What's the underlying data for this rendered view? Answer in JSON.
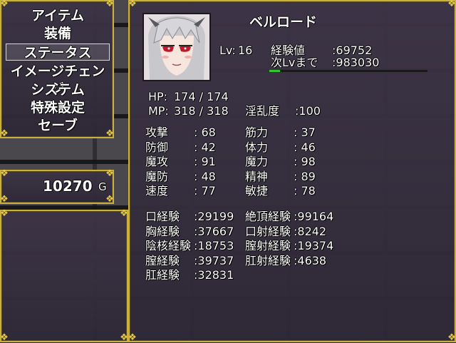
{
  "menu": {
    "items": [
      "アイテム",
      "装備",
      "ステータス",
      "イメージチェンジ",
      "システム",
      "特殊設定",
      "セーブ"
    ],
    "selected_index": 2
  },
  "gold": {
    "amount": "10270",
    "unit": "G"
  },
  "character": {
    "name": "ベルロード",
    "level_label": "Lv:",
    "level": "16",
    "exp_label": "経験値",
    "exp_value": ":69752",
    "next_label": "次Lvまで",
    "next_value": ":983030",
    "next_progress": 0.066,
    "hp_label": "HP:",
    "hp_value": "174 / 174",
    "mp_label": "MP:",
    "mp_value": "318 / 318",
    "lewd_label": "淫乱度",
    "lewd_value": ":100"
  },
  "stats": [
    {
      "label": "攻撃",
      "value": ": 68",
      "label2": "筋力",
      "value2": ": 37"
    },
    {
      "label": "防御",
      "value": ": 42",
      "label2": "体力",
      "value2": ": 46"
    },
    {
      "label": "魔攻",
      "value": ": 91",
      "label2": "魔力",
      "value2": ": 98"
    },
    {
      "label": "魔防",
      "value": ": 48",
      "label2": "精神",
      "value2": ": 89"
    },
    {
      "label": "速度",
      "value": ": 77",
      "label2": "敏捷",
      "value2": ": 78"
    }
  ],
  "experience": [
    {
      "label": "口経験",
      "value": ":29199",
      "label2": "絶頂経験",
      "value2": ":99164"
    },
    {
      "label": "胸経験",
      "value": ":37667",
      "label2": "口射経験",
      "value2": ":8242"
    },
    {
      "label": "陰核経験",
      "value": ":18753",
      "label2": "膣射経験",
      "value2": ":19374"
    },
    {
      "label": "膣経験",
      "value": ":39737",
      "label2": "肛射経験",
      "value2": ":4638"
    },
    {
      "label": "肛経験",
      "value": ":32831",
      "label2": "",
      "value2": ""
    }
  ],
  "colors": {
    "frame": "#c9b13a",
    "exp_bar": "#32c832"
  }
}
